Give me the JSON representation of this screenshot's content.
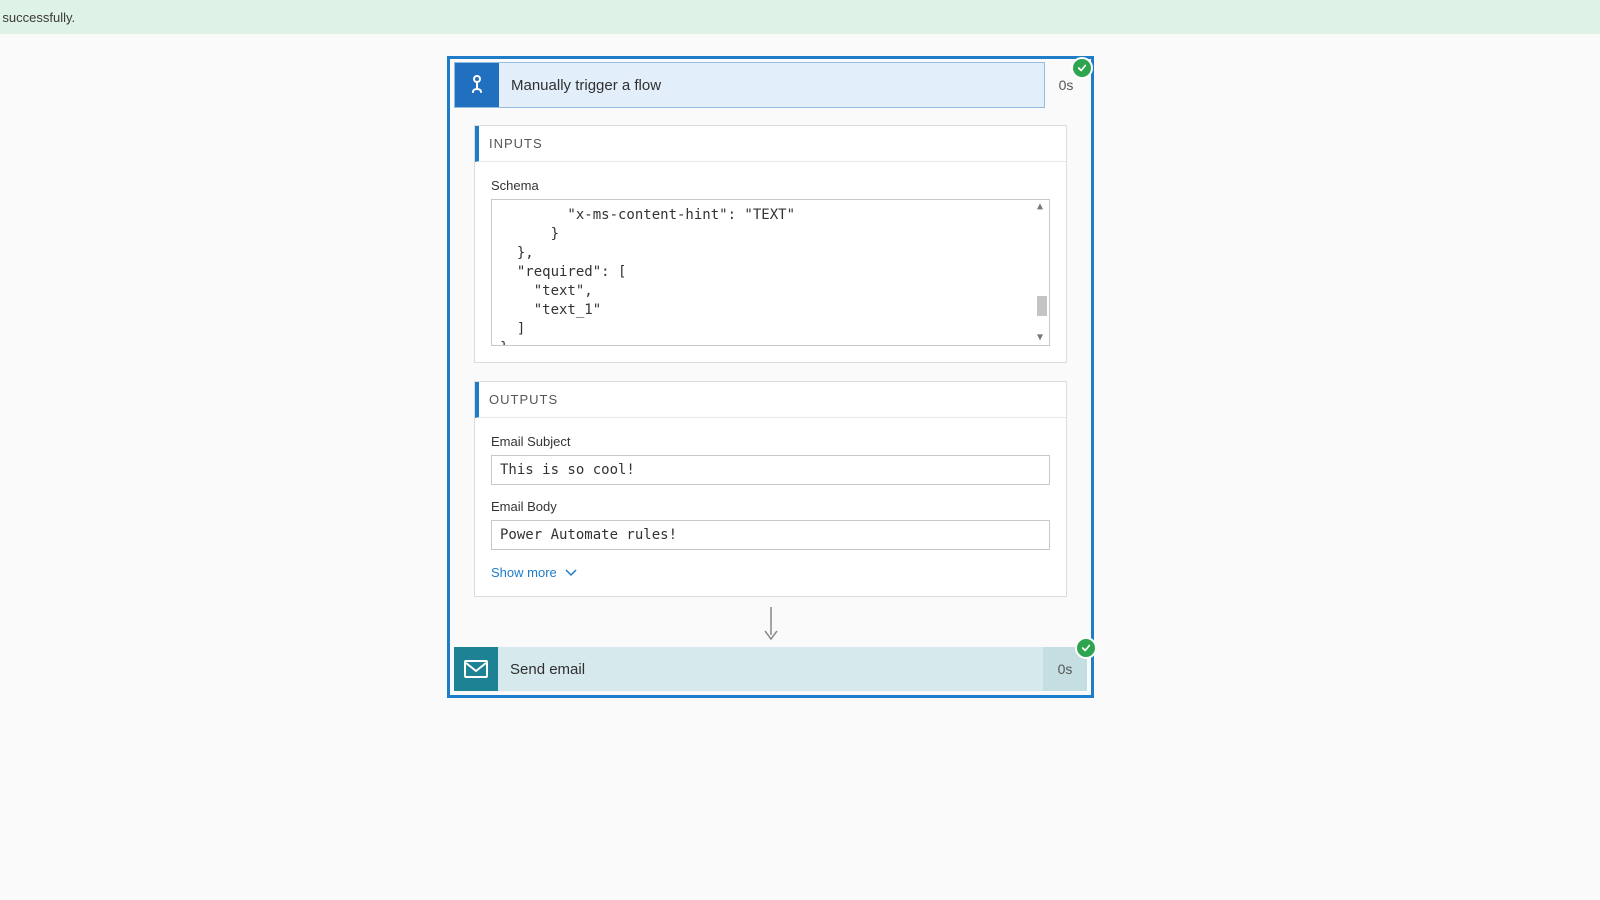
{
  "banner": {
    "text": "ran successfully."
  },
  "trigger": {
    "title": "Manually trigger a flow",
    "duration": "0s"
  },
  "inputs": {
    "header": "INPUTS",
    "schema_label": "Schema",
    "schema_code": "        \"x-ms-content-hint\": \"TEXT\"\n      }\n  },\n  \"required\": [\n    \"text\",\n    \"text_1\"\n  ]\n}"
  },
  "outputs": {
    "header": "OUTPUTS",
    "fields": [
      {
        "label": "Email Subject",
        "value": "This is so cool!"
      },
      {
        "label": "Email Body",
        "value": "Power Automate rules!"
      }
    ],
    "show_more": "Show more"
  },
  "action": {
    "title": "Send email",
    "duration": "0s"
  }
}
